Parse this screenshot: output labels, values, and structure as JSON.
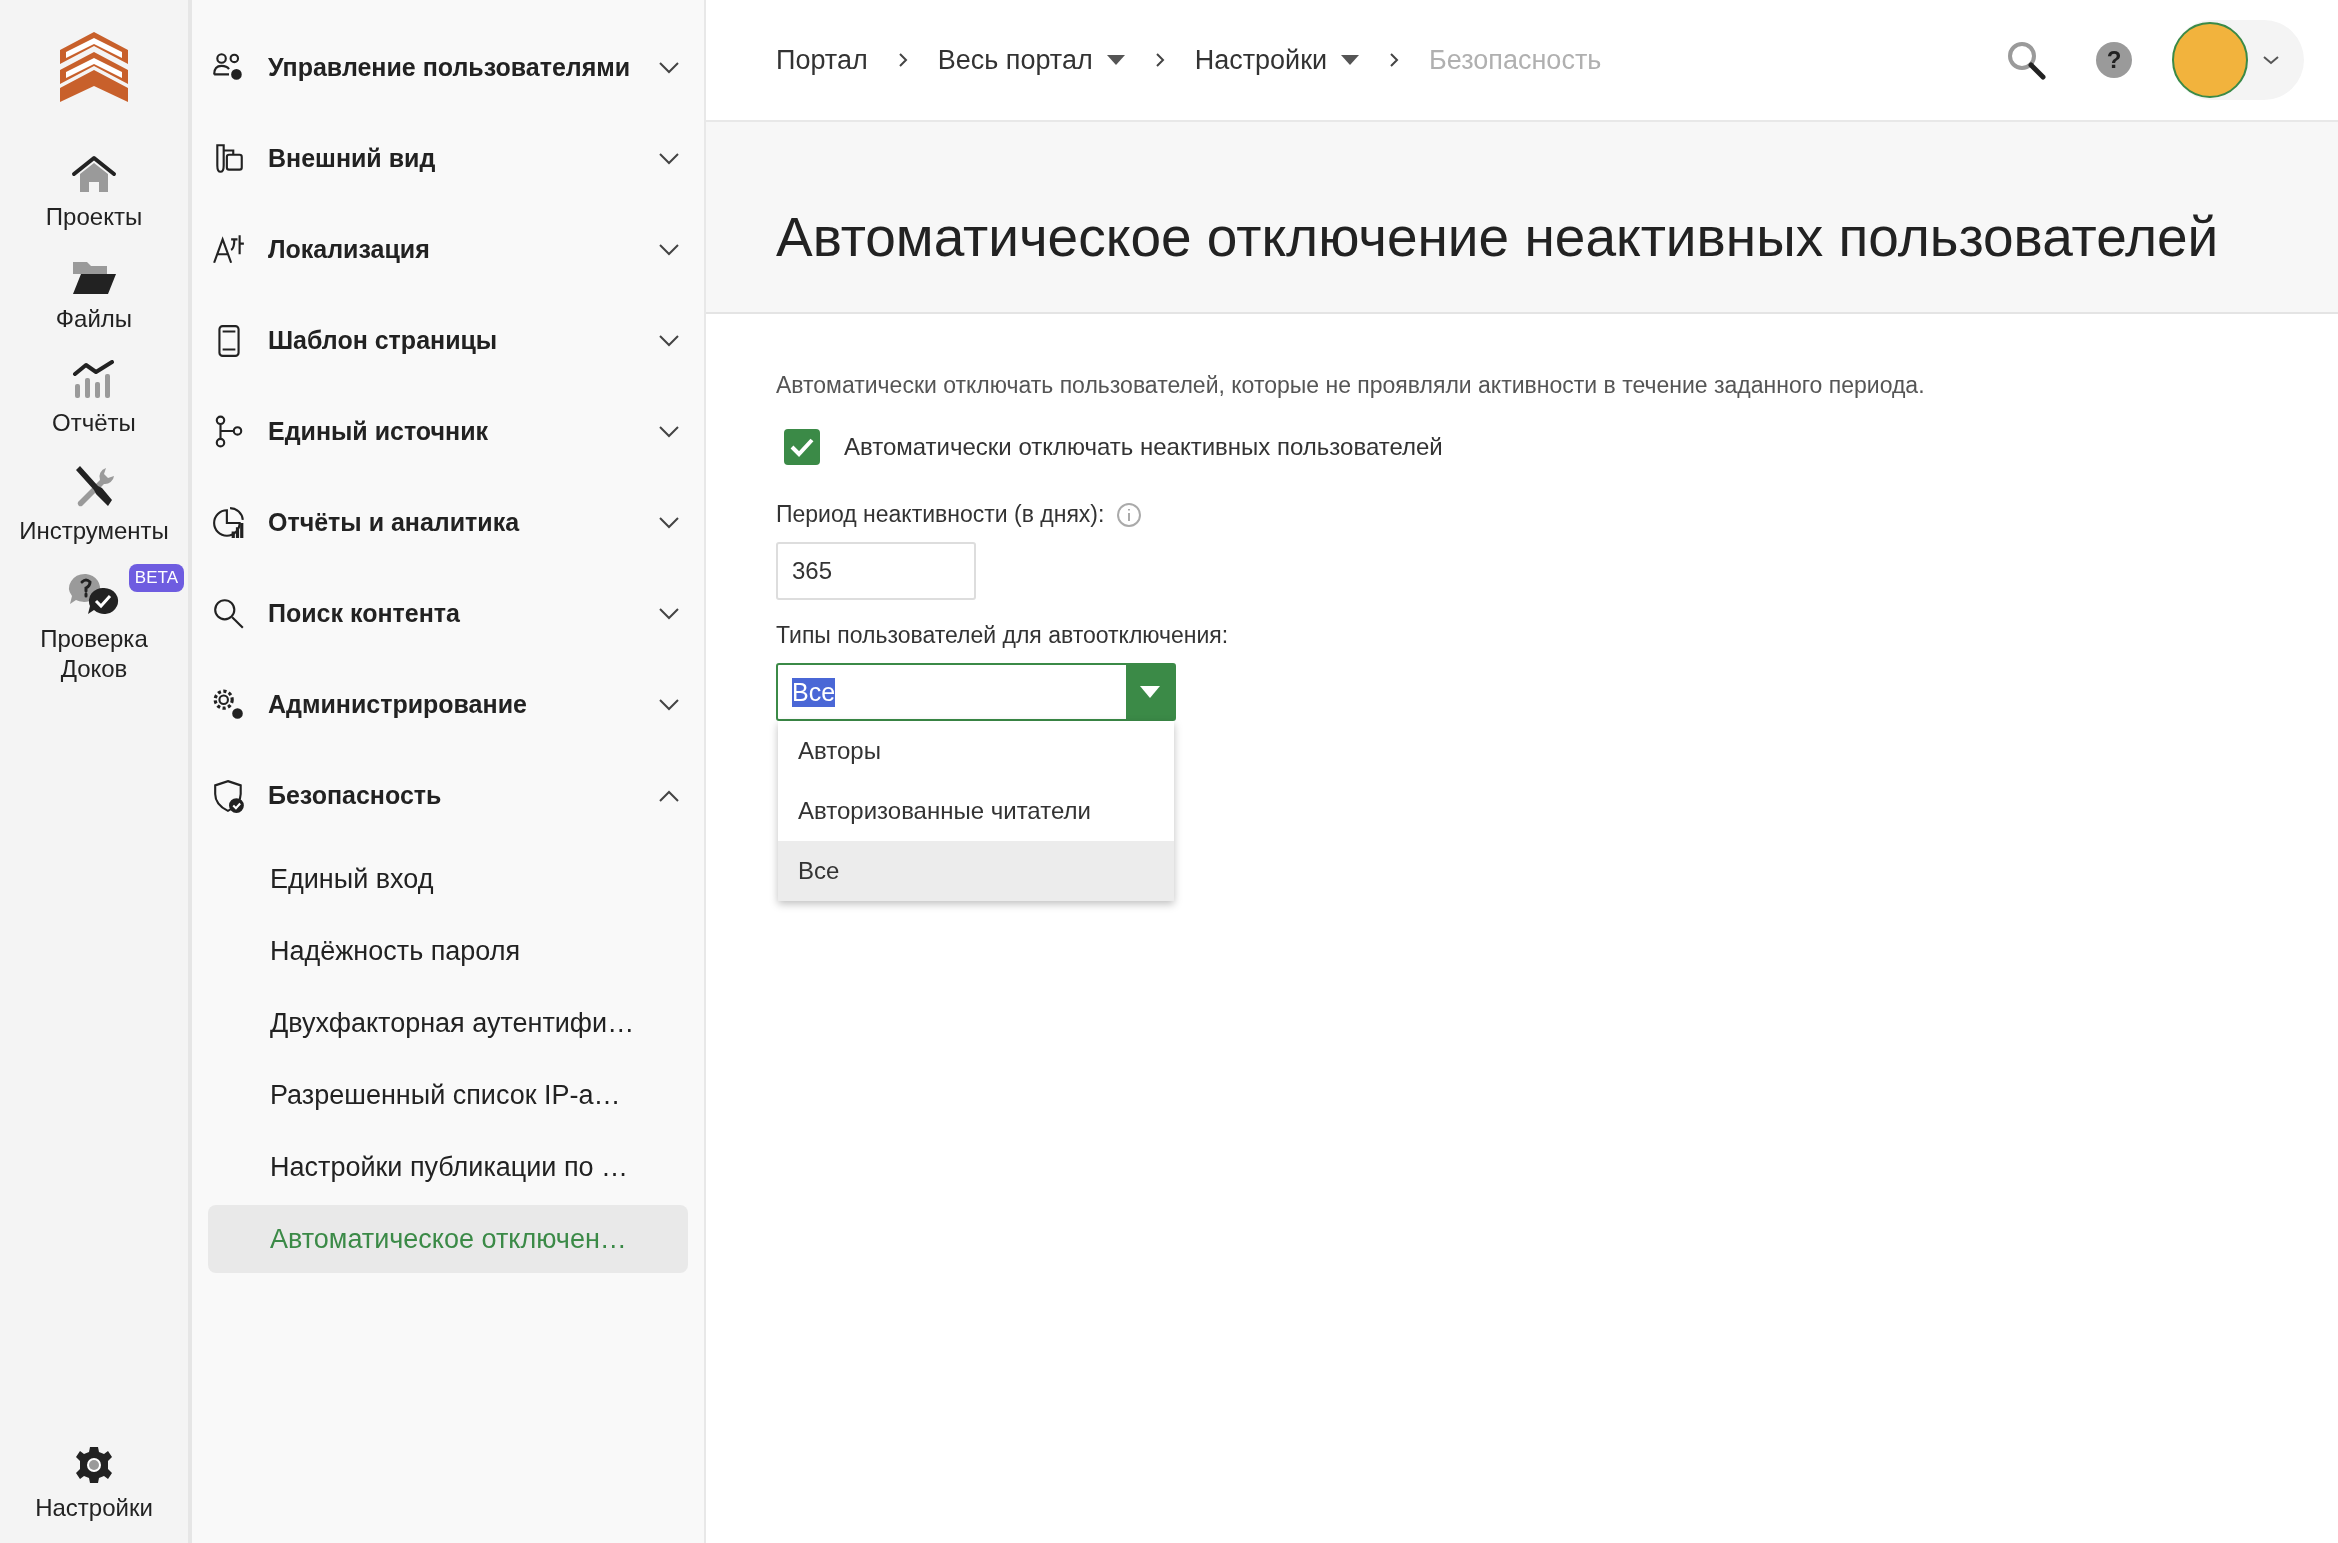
{
  "rail": {
    "items": [
      {
        "label": "Проекты"
      },
      {
        "label": "Файлы"
      },
      {
        "label": "Отчёты"
      },
      {
        "label": "Инструменты"
      },
      {
        "label": "Проверка Доков",
        "badge": "BETA"
      }
    ],
    "bottom": {
      "label": "Настройки"
    }
  },
  "sidebar": {
    "sections": [
      {
        "label": "Управление пользователями",
        "expanded": false
      },
      {
        "label": "Внешний вид",
        "expanded": false
      },
      {
        "label": "Локализация",
        "expanded": false
      },
      {
        "label": "Шаблон страницы",
        "expanded": false
      },
      {
        "label": "Единый источник",
        "expanded": false
      },
      {
        "label": "Отчёты и аналитика",
        "expanded": false
      },
      {
        "label": "Поиск контента",
        "expanded": false
      },
      {
        "label": "Администрирование",
        "expanded": false
      },
      {
        "label": "Безопасность",
        "expanded": true,
        "children": [
          {
            "label": "Единый вход",
            "selected": false
          },
          {
            "label": "Надёжность пароля",
            "selected": false
          },
          {
            "label": "Двухфакторная аутентифи…",
            "selected": false
          },
          {
            "label": "Разрешенный список IP-а…",
            "selected": false
          },
          {
            "label": "Настройки публикации по …",
            "selected": false
          },
          {
            "label": "Автоматическое отключен…",
            "selected": true
          }
        ]
      }
    ]
  },
  "breadcrumbs": [
    {
      "label": "Портал",
      "dropdown": false,
      "current": false
    },
    {
      "label": "Весь портал",
      "dropdown": true,
      "current": false
    },
    {
      "label": "Настройки",
      "dropdown": true,
      "current": false
    },
    {
      "label": "Безопасность",
      "dropdown": false,
      "current": true
    }
  ],
  "help": {
    "label": "?"
  },
  "page": {
    "title": "Автоматическое отключение неактивных пользователей",
    "description": "Автоматически отключать пользователей, которые не проявляли активности в течение заданного периода.",
    "checkbox": {
      "label": "Автоматически отключать неактивных пользователей",
      "checked": true
    },
    "period": {
      "label": "Период неактивности (в днях):",
      "value": "365"
    },
    "types": {
      "label": "Типы пользователей для автоотключения:",
      "value": "Все",
      "open": true,
      "options": [
        {
          "label": "Авторы",
          "selected": false
        },
        {
          "label": "Авторизованные читатели",
          "selected": false
        },
        {
          "label": "Все",
          "selected": true
        }
      ]
    }
  }
}
